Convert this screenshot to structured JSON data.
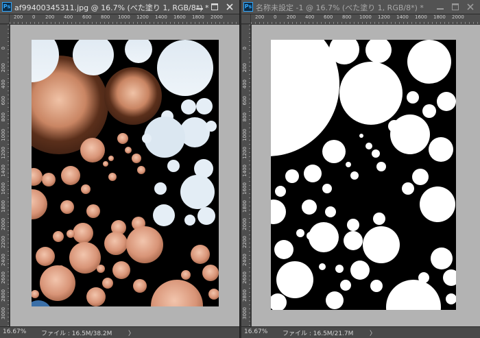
{
  "documents": [
    {
      "title": "af99400345311.jpg @ 16.7% (べた塗り 1, RGB/8*) *",
      "ruler_h_ticks": [
        "200",
        "0",
        "200",
        "400",
        "600",
        "800",
        "1000",
        "1200",
        "1400",
        "1600",
        "1800",
        "2000"
      ],
      "ruler_v_ticks": [
        "0",
        "200",
        "400",
        "600",
        "800",
        "1000",
        "1200",
        "1400",
        "1600",
        "1800",
        "2000",
        "2200",
        "2400",
        "2600",
        "2800",
        "3000"
      ],
      "zoom": "16.67%",
      "file_info": "ファイル : 16.5M/38.2M",
      "status_arrow": "〉",
      "canvas_content": "photo masked by circles"
    },
    {
      "title": "名称未設定 -1 @ 16.7% (べた塗り 1, RGB/8*) *",
      "ruler_h_ticks": [
        "200",
        "0",
        "200",
        "400",
        "600",
        "800",
        "1000",
        "1200",
        "1400",
        "1600",
        "1800",
        "2000"
      ],
      "ruler_v_ticks": [
        "0",
        "200",
        "400",
        "600",
        "800",
        "1000",
        "1200",
        "1400",
        "1600",
        "1800",
        "2000",
        "2200",
        "2400",
        "2600",
        "2800",
        "3000"
      ],
      "zoom": "16.67%",
      "file_info": "ファイル : 16.5M/21.7M",
      "status_arrow": "〉",
      "canvas_content": "white circles on black"
    }
  ],
  "icons": {
    "app": "photoshop-icon",
    "minimize": "minimize-icon",
    "restore": "restore-icon",
    "close": "close-icon"
  },
  "colors": {
    "canvas_bg": "#000000",
    "circle_white": "#ffffff",
    "pasteboard": "#b3b3b3"
  }
}
